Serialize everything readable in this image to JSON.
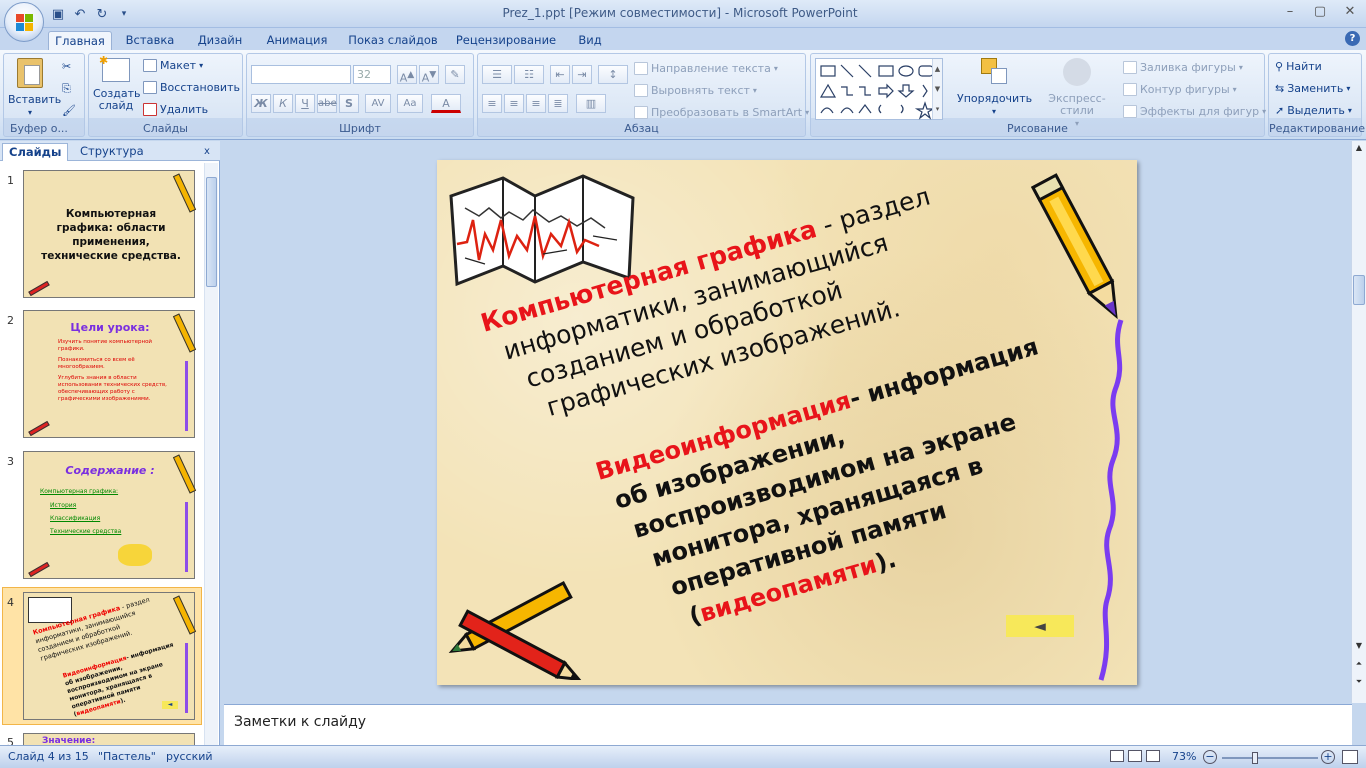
{
  "window": {
    "title": "Prez_1.ppt [Режим совместимости] - Microsoft PowerPoint"
  },
  "tabs": [
    "Главная",
    "Вставка",
    "Дизайн",
    "Анимация",
    "Показ слайдов",
    "Рецензирование",
    "Вид"
  ],
  "ribbon": {
    "clipboard": {
      "label": "Буфер о...",
      "paste": "Вставить"
    },
    "slides": {
      "label": "Слайды",
      "new_slide": "Создать слайд",
      "layout": "Макет",
      "reset": "Восстановить",
      "delete": "Удалить"
    },
    "font": {
      "label": "Шрифт",
      "size": "32",
      "bold": "Ж",
      "italic": "К",
      "underline": "Ч",
      "strike": "abe",
      "shadow": "S",
      "spacing": "AV",
      "case": "Aa",
      "color": "A"
    },
    "paragraph": {
      "label": "Абзац",
      "text_direction": "Направление текста",
      "align_text": "Выровнять текст",
      "smartart": "Преобразовать в SmartArt"
    },
    "drawing": {
      "label": "Рисование",
      "arrange": "Упорядочить",
      "quick_styles": "Экспресс-стили",
      "fill": "Заливка фигуры",
      "outline": "Контур фигуры",
      "effects": "Эффекты для фигур"
    },
    "editing": {
      "label": "Редактирование",
      "find": "Найти",
      "replace": "Заменить",
      "select": "Выделить"
    }
  },
  "left_pane": {
    "tabs": [
      "Слайды",
      "Структура"
    ],
    "thumbs": [
      {
        "num": "1",
        "title": "Компьютерная графика: области применения, технические средства."
      },
      {
        "num": "2",
        "title": "Цели урока:",
        "bullets": [
          "Изучить понятие компьютерной графики.",
          "Познакомиться со всем её многообразием.",
          "Углубить знания в области использования технических средств, обеспечивающих работу с графическими изображениями."
        ]
      },
      {
        "num": "3",
        "title": "Содержание :",
        "sub": "Компьютерная графика:",
        "bullets": [
          "История",
          "Классификация",
          "Технические средства"
        ]
      },
      {
        "num": "4"
      },
      {
        "num": "5",
        "title": "Значение:"
      }
    ]
  },
  "slide": {
    "p1_red": "Компьютерная графика",
    "p1_rest_1": " - раздел",
    "p1_line2": "информатики, занимающийся",
    "p1_line3": "созданием и обработкой",
    "p1_line4": "графических изображений.",
    "p2_red": "Видеоинформация",
    "p2_rest_1": "- информация",
    "p2_line2": "об изображении,",
    "p2_line3": "воспроизводимом на экране",
    "p2_line4": "монитора, хранящаяся в",
    "p2_line5": "оперативной памяти",
    "p2_l6a": "(",
    "p2_l6red": "видеопамяти",
    "p2_l6b": ").",
    "back_glyph": "◄"
  },
  "notes": {
    "placeholder": "Заметки к слайду"
  },
  "status": {
    "slide": "Слайд 4 из 15",
    "theme": "\"Пастель\"",
    "lang": "русский",
    "zoom": "73%"
  }
}
